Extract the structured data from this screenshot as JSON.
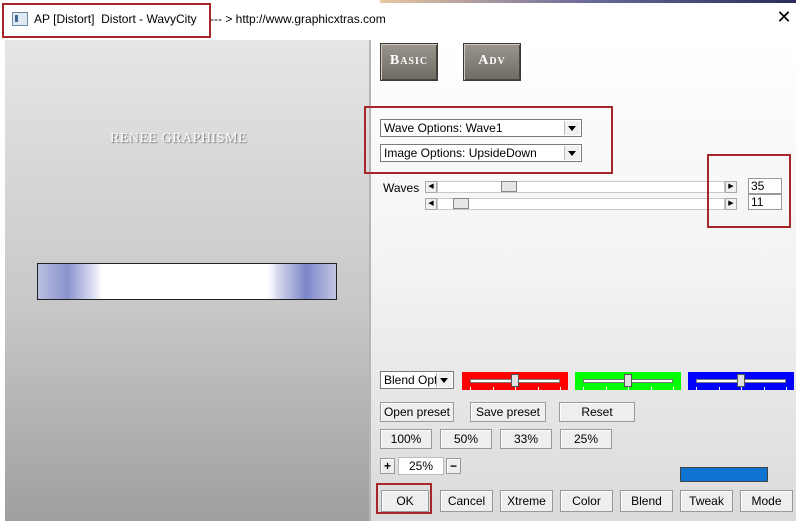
{
  "window": {
    "title": "AP [Distort]  Distort - WavyCity",
    "url_note": "--- > http://www.graphicxtras.com",
    "close_label": "✕"
  },
  "preview": {
    "watermark": "RENEE GRAPHISME"
  },
  "tabs": {
    "basic_label": "Basic",
    "adv_label": "Adv"
  },
  "options": {
    "wave_options": "Wave Options: Wave1",
    "image_options": "Image Options: UpsideDown"
  },
  "waves": {
    "label": "Waves",
    "slider1_value": "35",
    "slider2_value": "11",
    "slider1_level": 0.17,
    "slider2_level": 0.06
  },
  "blend": {
    "select_value": "Blend Optio",
    "colors": {
      "red": "#ff0000",
      "green": "#00ff00",
      "blue": "#0000ff"
    },
    "levels": {
      "red": 0.5,
      "green": 0.5,
      "blue": 0.5
    }
  },
  "preset": {
    "open_label": "Open preset",
    "save_label": "Save preset",
    "reset_label": "Reset"
  },
  "zoom": {
    "z100": "100%",
    "z50": "50%",
    "z33": "33%",
    "z25": "25%",
    "plus": "+",
    "minus": "−",
    "current": "25%"
  },
  "accent_color": "#0f73d1",
  "actions": {
    "ok": "OK",
    "cancel": "Cancel",
    "xtreme": "Xtreme",
    "color": "Color",
    "blend": "Blend",
    "tweak": "Tweak",
    "mode": "Mode"
  }
}
